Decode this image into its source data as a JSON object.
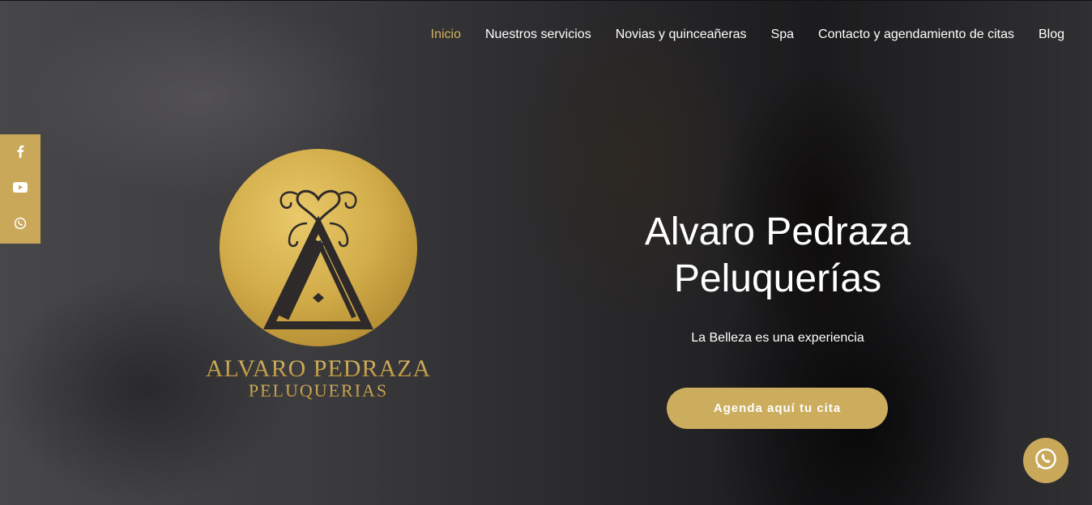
{
  "nav": {
    "items": [
      {
        "label": "Inicio",
        "active": true
      },
      {
        "label": "Nuestros servicios"
      },
      {
        "label": "Novias y quinceañeras"
      },
      {
        "label": "Spa"
      },
      {
        "label": "Contacto y agendamiento de citas"
      },
      {
        "label": "Blog"
      }
    ]
  },
  "social": {
    "icons": [
      "facebook-icon",
      "youtube-icon",
      "whatsapp-icon"
    ]
  },
  "logo": {
    "line1": "ALVARO PEDRAZA",
    "line2": "PELUQUERIAS"
  },
  "hero": {
    "title_line1": "Alvaro Pedraza",
    "title_line2": "Peluquerías",
    "tagline": "La Belleza es una experiencia",
    "cta_label": "Agenda aquí tu cita"
  },
  "colors": {
    "accent": "#c9a85a",
    "nav_active": "#d4b35c"
  }
}
